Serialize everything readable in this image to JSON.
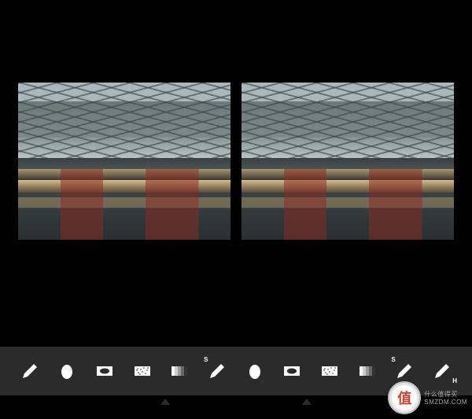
{
  "toolbar": {
    "tools": [
      {
        "name": "brush",
        "icon": "brush"
      },
      {
        "name": "blob",
        "icon": "blob"
      },
      {
        "name": "vignette-rect",
        "icon": "vignette"
      },
      {
        "name": "noise",
        "icon": "noise"
      },
      {
        "name": "gradient",
        "icon": "gradient"
      },
      {
        "name": "sharpen-brush",
        "icon": "brush",
        "badge": "S"
      },
      {
        "name": "blob-2",
        "icon": "blob"
      },
      {
        "name": "vignette-rect-2",
        "icon": "vignette"
      },
      {
        "name": "noise-2",
        "icon": "noise"
      },
      {
        "name": "gradient-2",
        "icon": "gradient"
      },
      {
        "name": "sharpen-brush-2",
        "icon": "brush",
        "badge": "S"
      },
      {
        "name": "highlight-brush",
        "icon": "brush",
        "badge": "H"
      }
    ]
  },
  "watermark": {
    "character": "值",
    "line1": "什么值得买",
    "line2": "SMZDM.COM"
  }
}
